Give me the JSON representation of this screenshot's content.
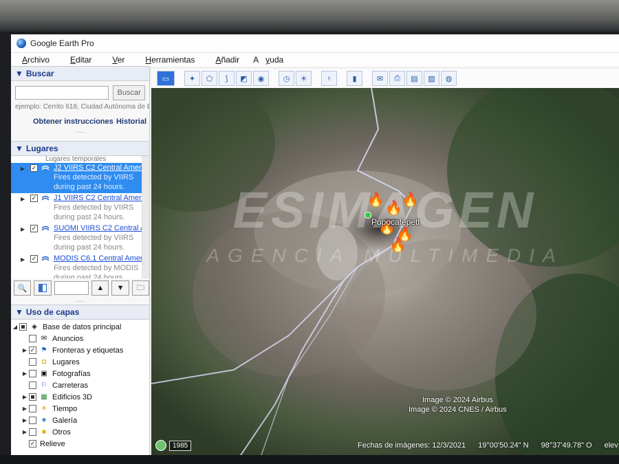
{
  "app": {
    "title": "Google Earth Pro"
  },
  "menu": [
    {
      "pre": "",
      "u": "A",
      "post": "rchivo"
    },
    {
      "pre": "",
      "u": "E",
      "post": "ditar"
    },
    {
      "pre": "",
      "u": "V",
      "post": "er"
    },
    {
      "pre": "",
      "u": "H",
      "post": "erramientas"
    },
    {
      "pre": "",
      "u": "A",
      "post": "ñadir"
    },
    {
      "pre": "A",
      "u": "y",
      "post": "uda"
    }
  ],
  "search": {
    "header": "Buscar",
    "button": "Buscar",
    "hint": "ejemplo: Cerrito 618, Ciudad Autónoma de B",
    "directions": "Obtener instrucciones",
    "history": "Historial"
  },
  "places": {
    "header": "Lugares",
    "top_label": "Lugares temporales",
    "items": [
      {
        "title": "J2 VIIRS C2 Central Americ",
        "desc1": "Fires detected by VIIRS",
        "desc2": "during past 24 hours."
      },
      {
        "title": "J1 VIIRS C2 Central Americ",
        "desc1": "Fires detected by VIIRS",
        "desc2": "during past 24 hours."
      },
      {
        "title": "SUOMI VIIRS C2 Central Am",
        "desc1": "Fires detected by VIIRS",
        "desc2": "during past 24 hours."
      },
      {
        "title": "MODIS C6.1 Central Americ",
        "desc1": "Fires detected by MODIS",
        "desc2": "during past 24 hours."
      }
    ]
  },
  "layers": {
    "header": "Uso de capas",
    "root": "Base de datos principal",
    "items": [
      {
        "label": "Anuncios",
        "checked": false,
        "icon": "envelope-icon"
      },
      {
        "label": "Fronteras y etiquetas",
        "checked": true,
        "icon": "flag-icon"
      },
      {
        "label": "Lugares",
        "checked": false,
        "icon": "square-icon"
      },
      {
        "label": "Fotografías",
        "checked": false,
        "icon": "camera-icon"
      },
      {
        "label": "Carreteras",
        "checked": false,
        "icon": "road-icon"
      },
      {
        "label": "Edificios 3D",
        "checked": false,
        "icon": "building-icon"
      },
      {
        "label": "Tiempo",
        "checked": false,
        "icon": "sun-icon"
      },
      {
        "label": "Galería",
        "checked": false,
        "icon": "star-icon"
      },
      {
        "label": "Otros",
        "checked": false,
        "icon": "folder-icon"
      },
      {
        "label": "Relieve",
        "checked": true,
        "icon": ""
      }
    ]
  },
  "map": {
    "placemark": "Popocatépetl",
    "attribution1": "Image © 2024 Airbus",
    "attribution2": "Image © 2024 CNES / Airbus",
    "date_label": "Fechas de imágenes: 12/3/2021",
    "lat": "19°00'50.24\" N",
    "lon": "98°37'49.78\" O",
    "elev": "elev",
    "year": "1985"
  },
  "watermark": {
    "main": "ESIMAGEN",
    "sub": "AGENCIA MULTIMEDIA"
  },
  "colors": {
    "selection": "#2f8cf0",
    "link": "#1a4bd6"
  }
}
